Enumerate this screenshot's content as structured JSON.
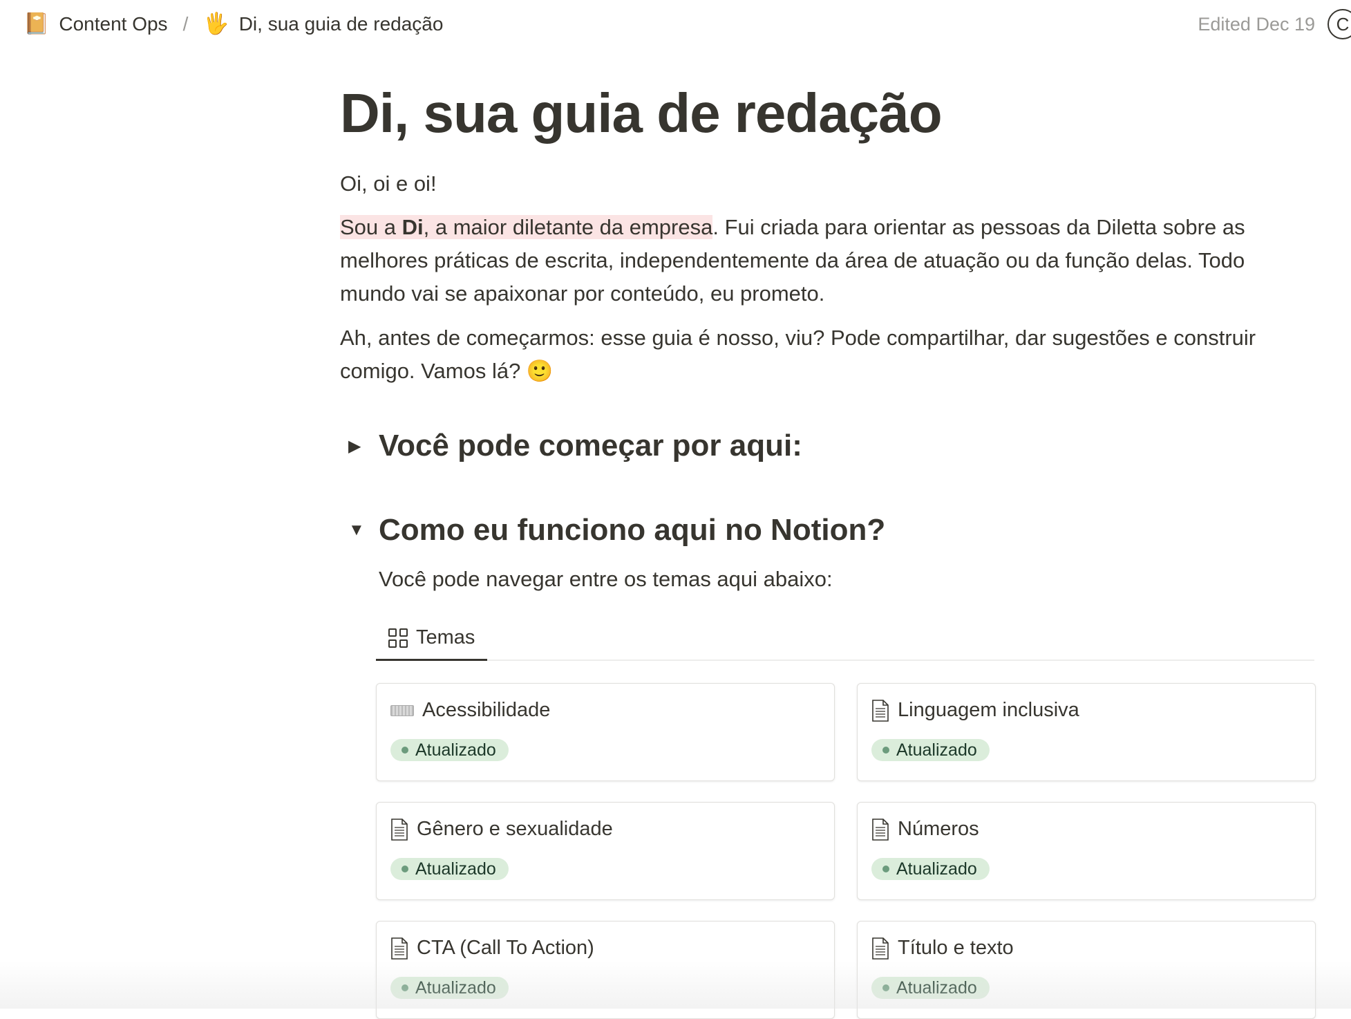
{
  "breadcrumb": {
    "workspace": {
      "icon": "📔",
      "label": "Content Ops"
    },
    "separator": "/",
    "page": {
      "icon": "🖐",
      "label": "Di, sua guia de redação"
    }
  },
  "topbar": {
    "edited": "Edited Dec 19",
    "avatar_letter": "C"
  },
  "page": {
    "title": "Di, sua guia de redação",
    "greeting": "Oi, oi e oi!",
    "intro": {
      "prefix": "Sou a ",
      "name": "Di",
      "highlight_rest": ", a maior diletante da empresa",
      "rest": ". Fui criada para orientar as pessoas da Diletta sobre as melhores práticas de escrita, independentemente da área de atuação ou da função delas. Todo mundo vai se apaixonar por conteúdo, eu prometo."
    },
    "closing": "Ah, antes de começarmos: esse guia é nosso, viu? Pode compartilhar, dar sugestões e construir comigo. Vamos lá? 🙂",
    "toggles": [
      {
        "arrow": "▶",
        "label": "Você pode começar por aqui:"
      },
      {
        "arrow": "▼",
        "label": "Como eu funciono aqui no Notion?"
      }
    ],
    "subtext": "Você pode navegar entre os temas aqui abaixo:",
    "tab": {
      "icon": "gallery-grid-icon",
      "label": "Temas"
    }
  },
  "cards": [
    {
      "title": "Acessibilidade",
      "icon": "keyboard-icon",
      "status": "Atualizado"
    },
    {
      "title": "Linguagem inclusiva",
      "icon": "document-icon",
      "status": "Atualizado"
    },
    {
      "title": "Gênero e sexualidade",
      "icon": "document-icon",
      "status": "Atualizado"
    },
    {
      "title": "Números",
      "icon": "document-icon",
      "status": "Atualizado"
    },
    {
      "title": "CTA (Call To Action)",
      "icon": "document-icon",
      "status": "Atualizado"
    },
    {
      "title": "Título e texto",
      "icon": "document-icon",
      "status": "Atualizado"
    }
  ],
  "colors": {
    "text": "#37352f",
    "muted": "#9b9a97",
    "highlight": "#fbe4e4",
    "status_bg": "#dbeddb",
    "status_dot": "#6c9b7d"
  }
}
